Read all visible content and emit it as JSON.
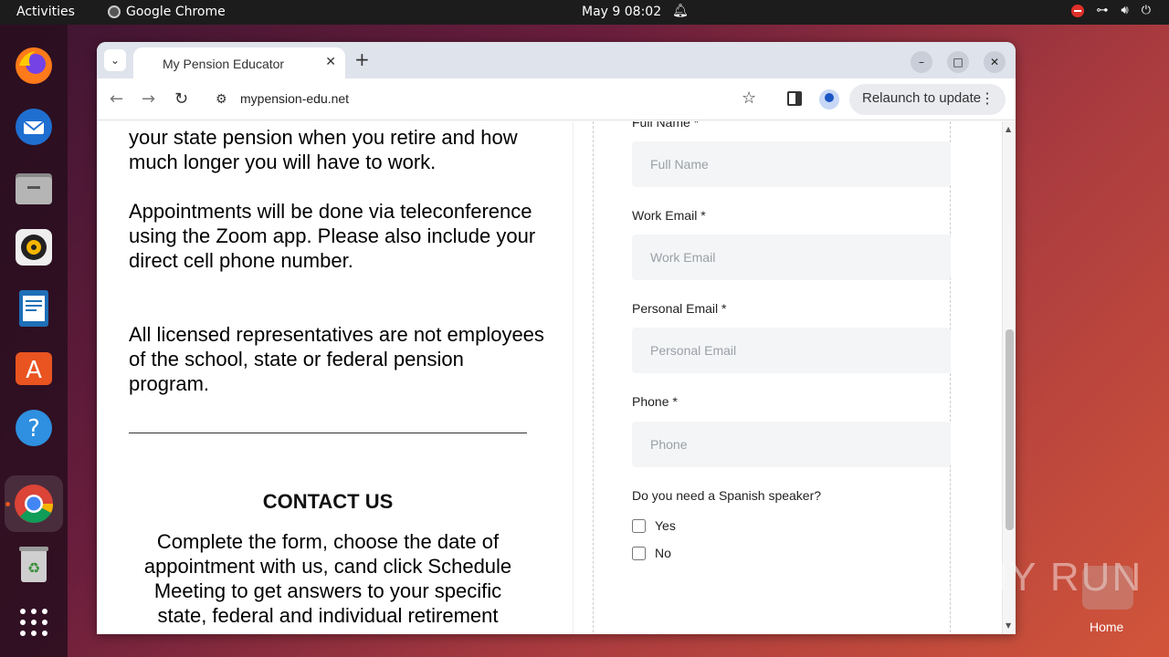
{
  "topbar": {
    "activities": "Activities",
    "app_name": "Google Chrome",
    "clock": "May 9  08:02"
  },
  "dock": {
    "items": [
      "firefox-icon",
      "thunderbird-icon",
      "files-icon",
      "rhythmbox-icon",
      "writer-icon",
      "app-center-icon",
      "help-icon",
      "chrome-icon",
      "trash-icon",
      "app-grid-icon"
    ]
  },
  "browser": {
    "tab_title": "My Pension Educator",
    "url": "mypension-edu.net",
    "relaunch_label": "Relaunch to update"
  },
  "page": {
    "left_paragraphs": [
      "your state pension when you retire and how much longer you will have to work.",
      "Appointments will be done via teleconference using the Zoom app. Please also include your direct cell phone number.",
      "All licensed representatives are not employees of the school, state or federal pension program."
    ],
    "contact_title": "CONTACT US",
    "contact_desc": "Complete the form, choose the date of appointment with us, cand click Schedule Meeting to get answers to your specific state, federal and individual retirement",
    "form": {
      "full_name_label": "Full Name *",
      "full_name_placeholder": "Full Name",
      "work_email_label": "Work Email *",
      "work_email_placeholder": "Work Email",
      "personal_email_label": "Personal Email *",
      "personal_email_placeholder": "Personal Email",
      "phone_label": "Phone *",
      "phone_placeholder": "Phone",
      "spanish_question": "Do you need a Spanish speaker?",
      "option_yes": "Yes",
      "option_no": "No"
    }
  },
  "desktop": {
    "watermark": "ANY RUN",
    "home_label": "Home"
  }
}
